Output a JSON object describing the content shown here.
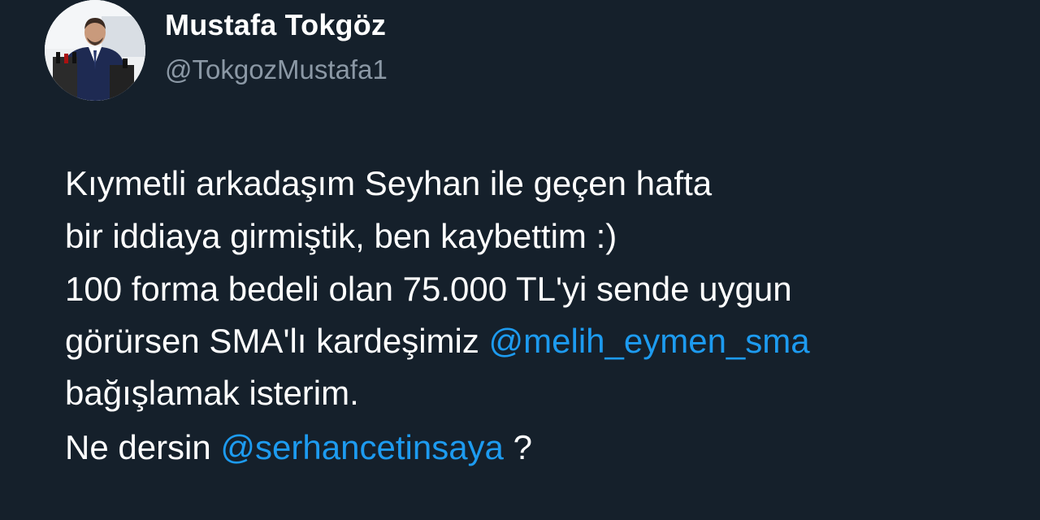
{
  "tweet": {
    "display_name": "Mustafa Tokgöz",
    "handle": "@TokgozMustafa1",
    "avatar_icon": "profile-photo",
    "lines": [
      {
        "text": "Kıymetli arkadaşım Seyhan ile geçen hafta"
      },
      {
        "text": "bir iddiaya girmiştik, ben kaybettim :)"
      },
      {
        "text": "100 forma bedeli olan 75.000 TL'yi sende uygun"
      },
      {
        "pre": "görürsen SMA'lı kardeşimiz ",
        "mention": "@melih_eymen_sma"
      },
      {
        "text": "bağışlamak isterim."
      },
      {
        "pre": "Ne dersin ",
        "mention": "@serhancetinsaya",
        "post": " ?"
      }
    ]
  },
  "colors": {
    "background": "#15202b",
    "text": "#ffffff",
    "handle": "#8b98a5",
    "mention": "#1d9bf0"
  }
}
